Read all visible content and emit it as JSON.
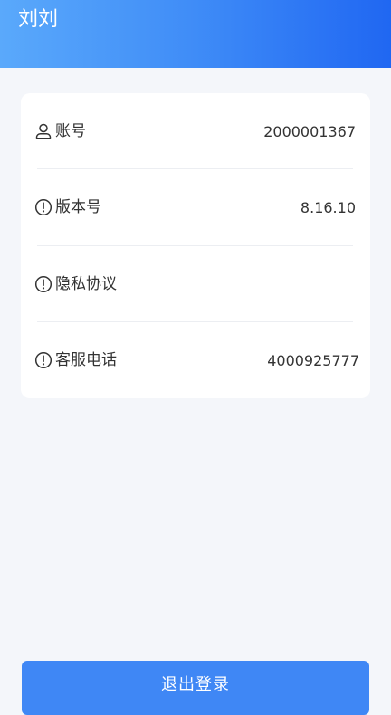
{
  "header": {
    "title": "刘刘"
  },
  "settings": {
    "items": [
      {
        "icon": "user-icon",
        "label": "账号",
        "value": "2000001367"
      },
      {
        "icon": "info-icon",
        "label": "版本号",
        "value": "8.16.10"
      },
      {
        "icon": "info-icon",
        "label": "隐私协议",
        "value": ""
      },
      {
        "icon": "info-icon",
        "label": "客服电话",
        "value": "4000925777"
      }
    ]
  },
  "logout": {
    "label": "退出登录"
  },
  "colors": {
    "accent": "#3f87f5",
    "header_start": "#5aa9fb",
    "header_end": "#2067f2",
    "background": "#f4f6fa"
  }
}
